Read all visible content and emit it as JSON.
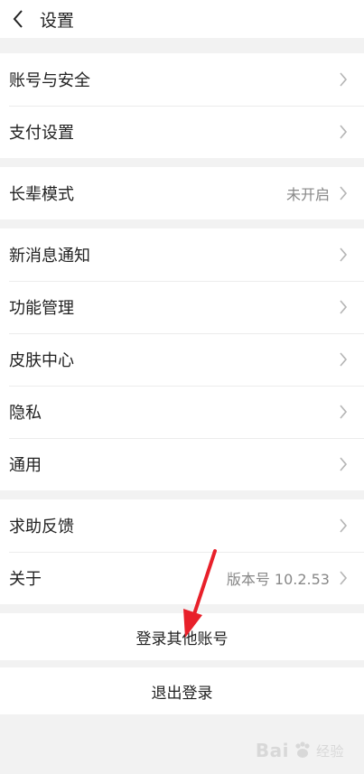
{
  "header": {
    "title": "设置"
  },
  "groups": [
    [
      {
        "label": "账号与安全",
        "value": ""
      },
      {
        "label": "支付设置",
        "value": ""
      }
    ],
    [
      {
        "label": "长辈模式",
        "value": "未开启"
      }
    ],
    [
      {
        "label": "新消息通知",
        "value": ""
      },
      {
        "label": "功能管理",
        "value": ""
      },
      {
        "label": "皮肤中心",
        "value": ""
      },
      {
        "label": "隐私",
        "value": ""
      },
      {
        "label": "通用",
        "value": ""
      }
    ],
    [
      {
        "label": "求助反馈",
        "value": ""
      },
      {
        "label": "关于",
        "value": "版本号 10.2.53"
      }
    ]
  ],
  "actions": {
    "switch_account": "登录其他账号",
    "logout": "退出登录"
  },
  "watermark": {
    "brand": "Bai",
    "suffix": "经验"
  },
  "colors": {
    "annotation_arrow": "#e8202a"
  }
}
